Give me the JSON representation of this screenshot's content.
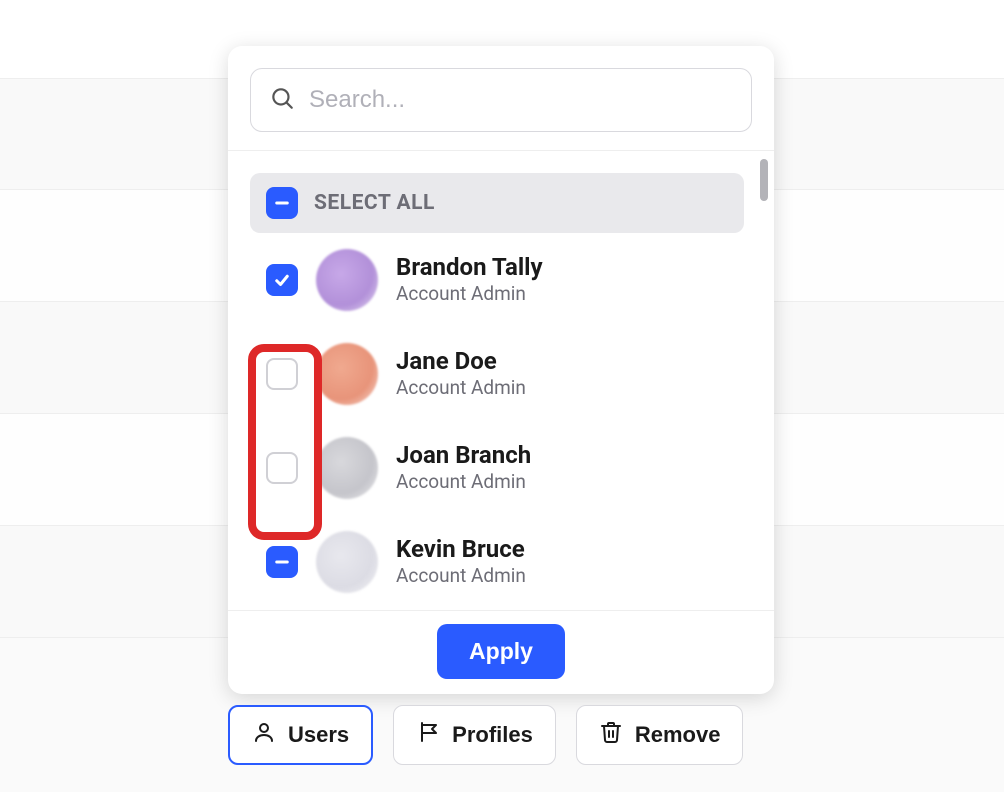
{
  "search": {
    "placeholder": "Search..."
  },
  "selectAll": {
    "label": "SELECT ALL",
    "state": "indeterminate"
  },
  "users": [
    {
      "name": "Brandon Tally",
      "role": "Account Admin",
      "state": "checked",
      "avatar": "purple"
    },
    {
      "name": "Jane Doe",
      "role": "Account Admin",
      "state": "unchecked",
      "avatar": "orange"
    },
    {
      "name": "Joan Branch",
      "role": "Account Admin",
      "state": "unchecked",
      "avatar": "gray"
    },
    {
      "name": "Kevin Bruce",
      "role": "Account Admin",
      "state": "indeterminate",
      "avatar": "light"
    }
  ],
  "applyButton": {
    "label": "Apply"
  },
  "toolbar": {
    "users": "Users",
    "profiles": "Profiles",
    "remove": "Remove"
  },
  "highlight": {
    "description": "Red annotation box highlighting unchecked checkboxes for Jane Doe and Joan Branch"
  }
}
